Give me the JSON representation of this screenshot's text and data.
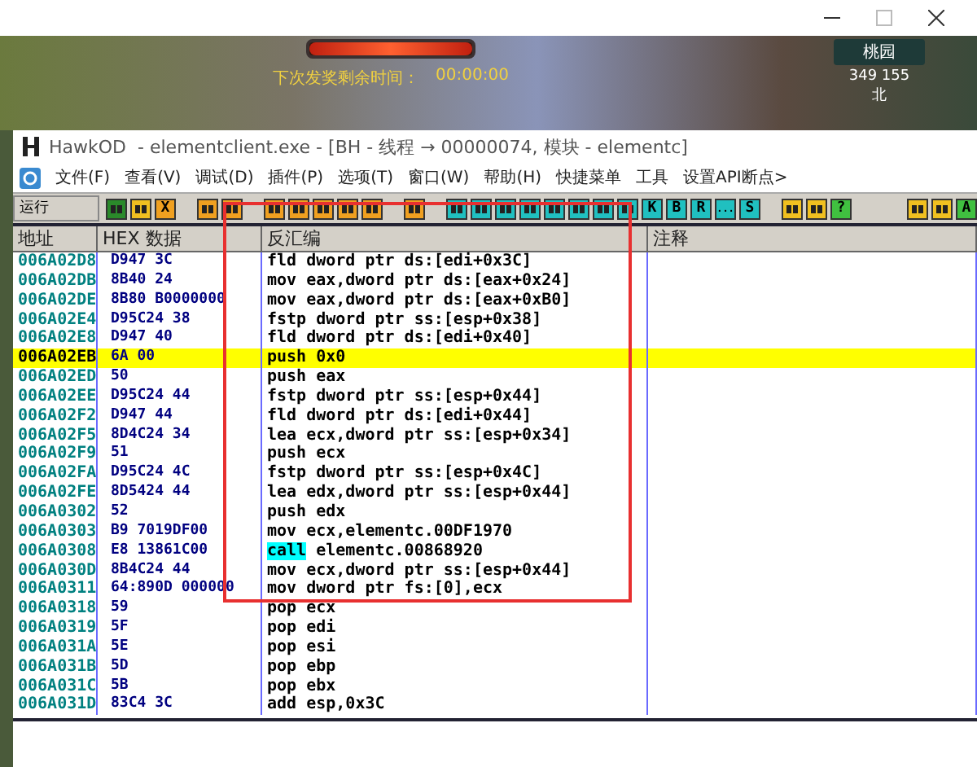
{
  "game": {
    "banner_label": "下次发奖剩余时间：",
    "banner_time": "00:00:00",
    "level": 1,
    "location": "桃园",
    "coordinates": "349 155",
    "direction": "北"
  },
  "window": {
    "app": "HawkOD",
    "title": "- elementclient.exe - [BH - 线程 → 00000074, 模块 - elementc]"
  },
  "menu": [
    "文件(F)",
    "查看(V)",
    "调试(D)",
    "插件(P)",
    "选项(T)",
    "窗口(W)",
    "帮助(H)",
    "快捷菜单",
    "工具",
    "设置API断点>"
  ],
  "toolbar": {
    "status": "运行",
    "groups": [
      [
        {
          "kind": "glyph",
          "color": "#2a8a2a"
        },
        {
          "kind": "glyph",
          "color": "#f0c020"
        },
        {
          "kind": "letter",
          "label": "X",
          "color": "#f0a020"
        }
      ],
      [
        {
          "kind": "glyph",
          "color": "#f0a020"
        },
        {
          "kind": "glyph",
          "color": "#f0a020"
        }
      ],
      [
        {
          "kind": "glyph",
          "color": "#f0a020"
        },
        {
          "kind": "glyph",
          "color": "#f0a020"
        },
        {
          "kind": "glyph",
          "color": "#f0a020"
        },
        {
          "kind": "glyph",
          "color": "#f0a020"
        },
        {
          "kind": "glyph",
          "color": "#f0a020"
        }
      ],
      [
        {
          "kind": "glyph",
          "color": "#f0a020"
        }
      ],
      [
        {
          "kind": "glyph",
          "color": "#20c0c0"
        },
        {
          "kind": "glyph",
          "color": "#20c0c0"
        },
        {
          "kind": "glyph",
          "color": "#20c0c0"
        },
        {
          "kind": "glyph",
          "color": "#20c0c0"
        },
        {
          "kind": "glyph",
          "color": "#20c0c0"
        },
        {
          "kind": "glyph",
          "color": "#20c0c0"
        },
        {
          "kind": "glyph",
          "color": "#20c0c0"
        },
        {
          "kind": "glyph",
          "color": "#20c0c0"
        },
        {
          "kind": "letter",
          "label": "K",
          "color": "#20c0c0"
        },
        {
          "kind": "letter",
          "label": "B",
          "color": "#20c0c0"
        },
        {
          "kind": "letter",
          "label": "R",
          "color": "#20c0c0"
        },
        {
          "kind": "letter",
          "label": "...",
          "color": "#20c0c0"
        },
        {
          "kind": "letter",
          "label": "S",
          "color": "#20c0c0"
        }
      ],
      [
        {
          "kind": "glyph",
          "color": "#f0c020"
        },
        {
          "kind": "glyph",
          "color": "#f0c020"
        },
        {
          "kind": "letter",
          "label": "?",
          "color": "#40c040"
        }
      ],
      [
        {
          "kind": "glyph",
          "color": "#f0c020"
        },
        {
          "kind": "glyph",
          "color": "#f0c020"
        },
        {
          "kind": "letter",
          "label": "A",
          "color": "#40c040"
        }
      ]
    ]
  },
  "table": {
    "columns": [
      "地址",
      "HEX 数据",
      "反汇编",
      "注释"
    ],
    "rows": [
      {
        "address": "006A02D8",
        "hex": "D947 3C",
        "mnemonic": "fld",
        "operands": "dword ptr ds:[edi+0x3C]",
        "selected": false
      },
      {
        "address": "006A02DB",
        "hex": "8B40 24",
        "mnemonic": "mov",
        "operands": "eax,dword ptr ds:[eax+0x24]",
        "selected": false
      },
      {
        "address": "006A02DE",
        "hex": "8B80 B0000000",
        "mnemonic": "mov",
        "operands": "eax,dword ptr ds:[eax+0xB0]",
        "selected": false
      },
      {
        "address": "006A02E4",
        "hex": "D95C24 38",
        "mnemonic": "fstp",
        "operands": "dword ptr ss:[esp+0x38]",
        "selected": false
      },
      {
        "address": "006A02E8",
        "hex": "D947 40",
        "mnemonic": "fld",
        "operands": "dword ptr ds:[edi+0x40]",
        "selected": false
      },
      {
        "address": "006A02EB",
        "hex": "6A 00",
        "mnemonic": "push",
        "operands": "0x0",
        "selected": true
      },
      {
        "address": "006A02ED",
        "hex": "50",
        "mnemonic": "push",
        "operands": "eax",
        "selected": false
      },
      {
        "address": "006A02EE",
        "hex": "D95C24 44",
        "mnemonic": "fstp",
        "operands": "dword ptr ss:[esp+0x44]",
        "selected": false
      },
      {
        "address": "006A02F2",
        "hex": "D947 44",
        "mnemonic": "fld",
        "operands": "dword ptr ds:[edi+0x44]",
        "selected": false
      },
      {
        "address": "006A02F5",
        "hex": "8D4C24 34",
        "mnemonic": "lea",
        "operands": "ecx,dword ptr ss:[esp+0x34]",
        "selected": false
      },
      {
        "address": "006A02F9",
        "hex": "51",
        "mnemonic": "push",
        "operands": "ecx",
        "selected": false
      },
      {
        "address": "006A02FA",
        "hex": "D95C24 4C",
        "mnemonic": "fstp",
        "operands": "dword ptr ss:[esp+0x4C]",
        "selected": false
      },
      {
        "address": "006A02FE",
        "hex": "8D5424 44",
        "mnemonic": "lea",
        "operands": "edx,dword ptr ss:[esp+0x44]",
        "selected": false
      },
      {
        "address": "006A0302",
        "hex": "52",
        "mnemonic": "push",
        "operands": "edx",
        "selected": false
      },
      {
        "address": "006A0303",
        "hex": "B9 7019DF00",
        "mnemonic": "mov",
        "operands": "ecx,elementc.00DF1970",
        "selected": false
      },
      {
        "address": "006A0308",
        "hex": "E8 13861C00",
        "mnemonic": "call",
        "operands": "elementc.00868920",
        "selected": false,
        "color": "#00ffff"
      },
      {
        "address": "006A030D",
        "hex": "8B4C24 44",
        "mnemonic": "mov",
        "operands": "ecx,dword ptr ss:[esp+0x44]",
        "selected": false
      },
      {
        "address": "006A0311",
        "hex": "64:890D 000000",
        "mnemonic": "mov",
        "operands": "dword ptr fs:[0],ecx",
        "selected": false
      },
      {
        "address": "006A0318",
        "hex": "59",
        "mnemonic": "pop",
        "operands": "ecx",
        "selected": false
      },
      {
        "address": "006A0319",
        "hex": "5F",
        "mnemonic": "pop",
        "operands": "edi",
        "selected": false
      },
      {
        "address": "006A031A",
        "hex": "5E",
        "mnemonic": "pop",
        "operands": "esi",
        "selected": false
      },
      {
        "address": "006A031B",
        "hex": "5D",
        "mnemonic": "pop",
        "operands": "ebp",
        "selected": false
      },
      {
        "address": "006A031C",
        "hex": "5B",
        "mnemonic": "pop",
        "operands": "ebx",
        "selected": false
      },
      {
        "address": "006A031D",
        "hex": "83C4 3C",
        "mnemonic": "add",
        "operands": "esp,0x3C",
        "selected": false
      }
    ]
  }
}
